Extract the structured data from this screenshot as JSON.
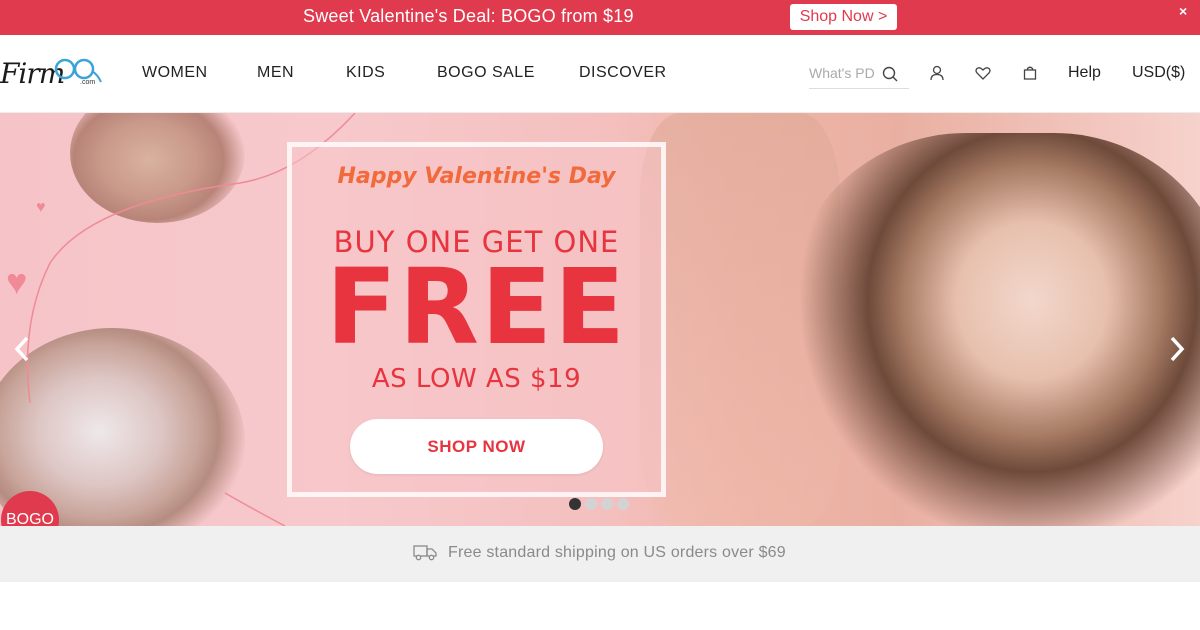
{
  "promo": {
    "text": "Sweet Valentine's Deal: BOGO from $19",
    "cta": "Shop Now >",
    "close": "×",
    "color": "#e03a4e"
  },
  "header": {
    "logo": {
      "main": "Firm",
      "accent": "oo",
      "suffix": ".com"
    },
    "nav": [
      "WOMEN",
      "MEN",
      "KIDS",
      "BOGO SALE",
      "DISCOVER"
    ],
    "search": {
      "placeholder": "What's PD"
    },
    "icons": [
      "search-icon",
      "account-icon",
      "wishlist-heart-icon",
      "shopping-bag-icon"
    ],
    "help": "Help",
    "currency": "USD($)"
  },
  "hero": {
    "tagline": "Happy Valentine's Day",
    "headline": "BUY ONE GET ONE",
    "big": "FREE",
    "sub": "AS LOW AS $19",
    "cta": "SHOP NOW",
    "accent_color": "#e8343e",
    "slides": {
      "count": 4,
      "active": 1
    }
  },
  "badge": {
    "label": "BOGO"
  },
  "shipping": {
    "text": "Free standard shipping on US orders over $69",
    "icon": "truck-icon"
  }
}
